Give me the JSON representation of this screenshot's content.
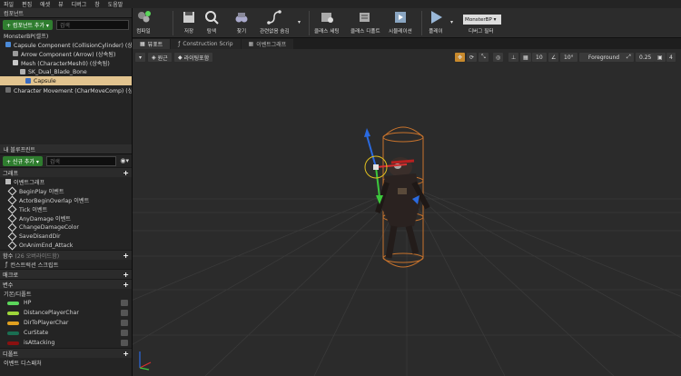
{
  "menu": [
    "파일",
    "편집",
    "애셋",
    "뷰",
    "디버그",
    "창",
    "도움말"
  ],
  "components": {
    "tab": "컴포넌트",
    "add_button": "+ 컴포넌트 추가 ▾",
    "search_placeholder": "검색",
    "root": "MonsterBP(셀프)",
    "tree": [
      "Capsule Component (CollisionCylinder) (상속됨)",
      "Arrow Component (Arrow) (상속됨)",
      "Mesh (CharacterMesh0) (상속됨)",
      "SK_Dual_Blade_Bone",
      "Capsule",
      "Character Movement (CharMoveComp) (상속됨)"
    ]
  },
  "blueprint": {
    "tab": "내 블루프린트",
    "add_button": "+ 신규 추가 ▾",
    "search_placeholder": "검색",
    "graph_header": "그래프",
    "event_graph": "이벤트그래프",
    "events": [
      "BeginPlay 이벤트",
      "ActorBeginOverlap 이벤트",
      "Tick 이벤트",
      "AnyDamage 이벤트",
      "ChangeDamageColor",
      "SaveDisandDir",
      "OnAnimEnd_Attack"
    ],
    "functions_header": "함수",
    "functions_override": "(26 오버라이드함)",
    "construction_script": "컨스트럭션 스크립트",
    "macros_header": "매크로",
    "variables_header": "변수",
    "components_header": "기본/디폴트",
    "variables": [
      {
        "name": "HP",
        "color": "#5bd65b"
      },
      {
        "name": "DistancePlayerChar",
        "color": "#9ed63a"
      },
      {
        "name": "DirToPlayerChar",
        "color": "#e0a020"
      },
      {
        "name": "CurState",
        "color": "#1a6e52"
      },
      {
        "name": "isAttacking",
        "color": "#8a1010"
      }
    ],
    "dispatchers_header": "디폴트",
    "dispatchers_sub": "이벤트 디스패처"
  },
  "toolbar": {
    "compile": "컴파일",
    "save": "저장",
    "browse": "탐색",
    "find": "찾기",
    "hide_unrelated": "관련없음 숨김",
    "class_settings": "클래스 세팅",
    "class_defaults": "클래스 디폴트",
    "simulation": "시뮬레이션",
    "play": "플레이",
    "debug_object": "MonsterBP ▾",
    "debug_filter": "디버그 필터"
  },
  "tabs": [
    "뷰포트",
    "Construction Scrip",
    "이벤트그래프"
  ],
  "viewport": {
    "perspective": "원근",
    "lit": "라이팅포함",
    "grid_snap": "10",
    "rot_snap": "10°",
    "layer": "Foreground",
    "scale_snap": "0.25",
    "cam_speed": "4"
  }
}
